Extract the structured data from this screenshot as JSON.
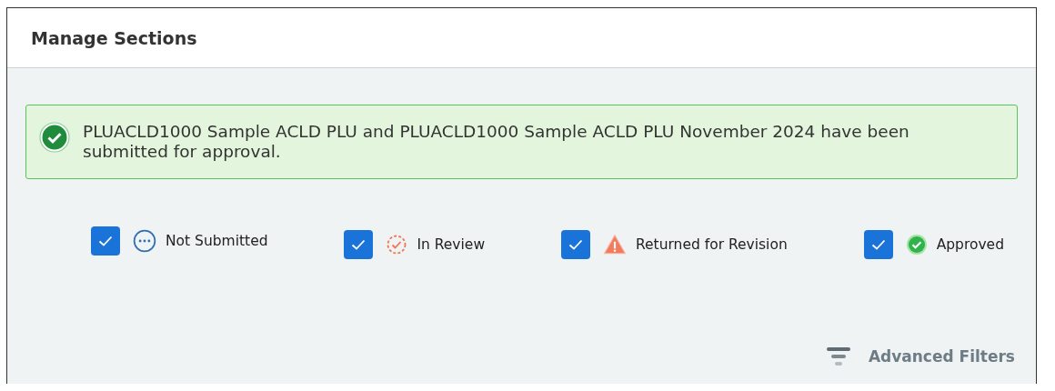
{
  "window": {
    "title": "Manage Sections"
  },
  "alert": {
    "kind": "success",
    "message": "PLUACLD1000 Sample ACLD PLU and PLUACLD1000 Sample ACLD PLU November 2024 have been submitted for approval."
  },
  "filters": [
    {
      "label": "Not Submitted",
      "kind": "not_submitted",
      "checked": true
    },
    {
      "label": "In Review",
      "kind": "in_review",
      "checked": true
    },
    {
      "label": "Returned for Revision",
      "kind": "returned",
      "checked": true
    },
    {
      "label": "Approved",
      "kind": "approved",
      "checked": true
    }
  ],
  "advanced_filters": {
    "label": "Advanced Filters"
  }
}
